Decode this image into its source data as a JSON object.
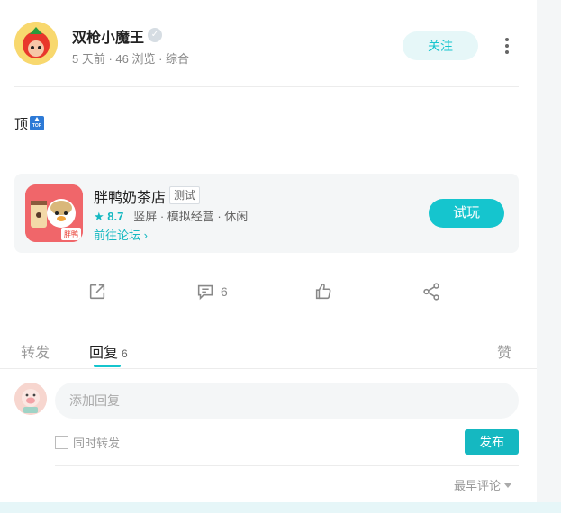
{
  "post": {
    "author": "双枪小魔王",
    "badge_icon": "verified-badge-icon",
    "meta": "5 天前 · 46 浏览 · 综合",
    "follow_label": "关注",
    "content": "顶",
    "top_icon_text": "TOP"
  },
  "game": {
    "name": "胖鸭奶茶店",
    "tag": "测试",
    "score": "8.7",
    "tags_text": "竖屏 · 模拟经营 · 休闲",
    "forum_link": "前往论坛",
    "play_label": "试玩",
    "icon_text": "胖鸭"
  },
  "actions": {
    "comment_count": "6"
  },
  "tabs": {
    "forward": "转发",
    "reply": "回复",
    "reply_count": "6",
    "like": "赞"
  },
  "reply_box": {
    "placeholder": "添加回复",
    "checkbox_label": "同时转发",
    "publish_label": "发布"
  },
  "sort": {
    "label": "最早评论"
  },
  "colors": {
    "accent": "#15c5ce",
    "accent_dark": "#15b8c1"
  }
}
